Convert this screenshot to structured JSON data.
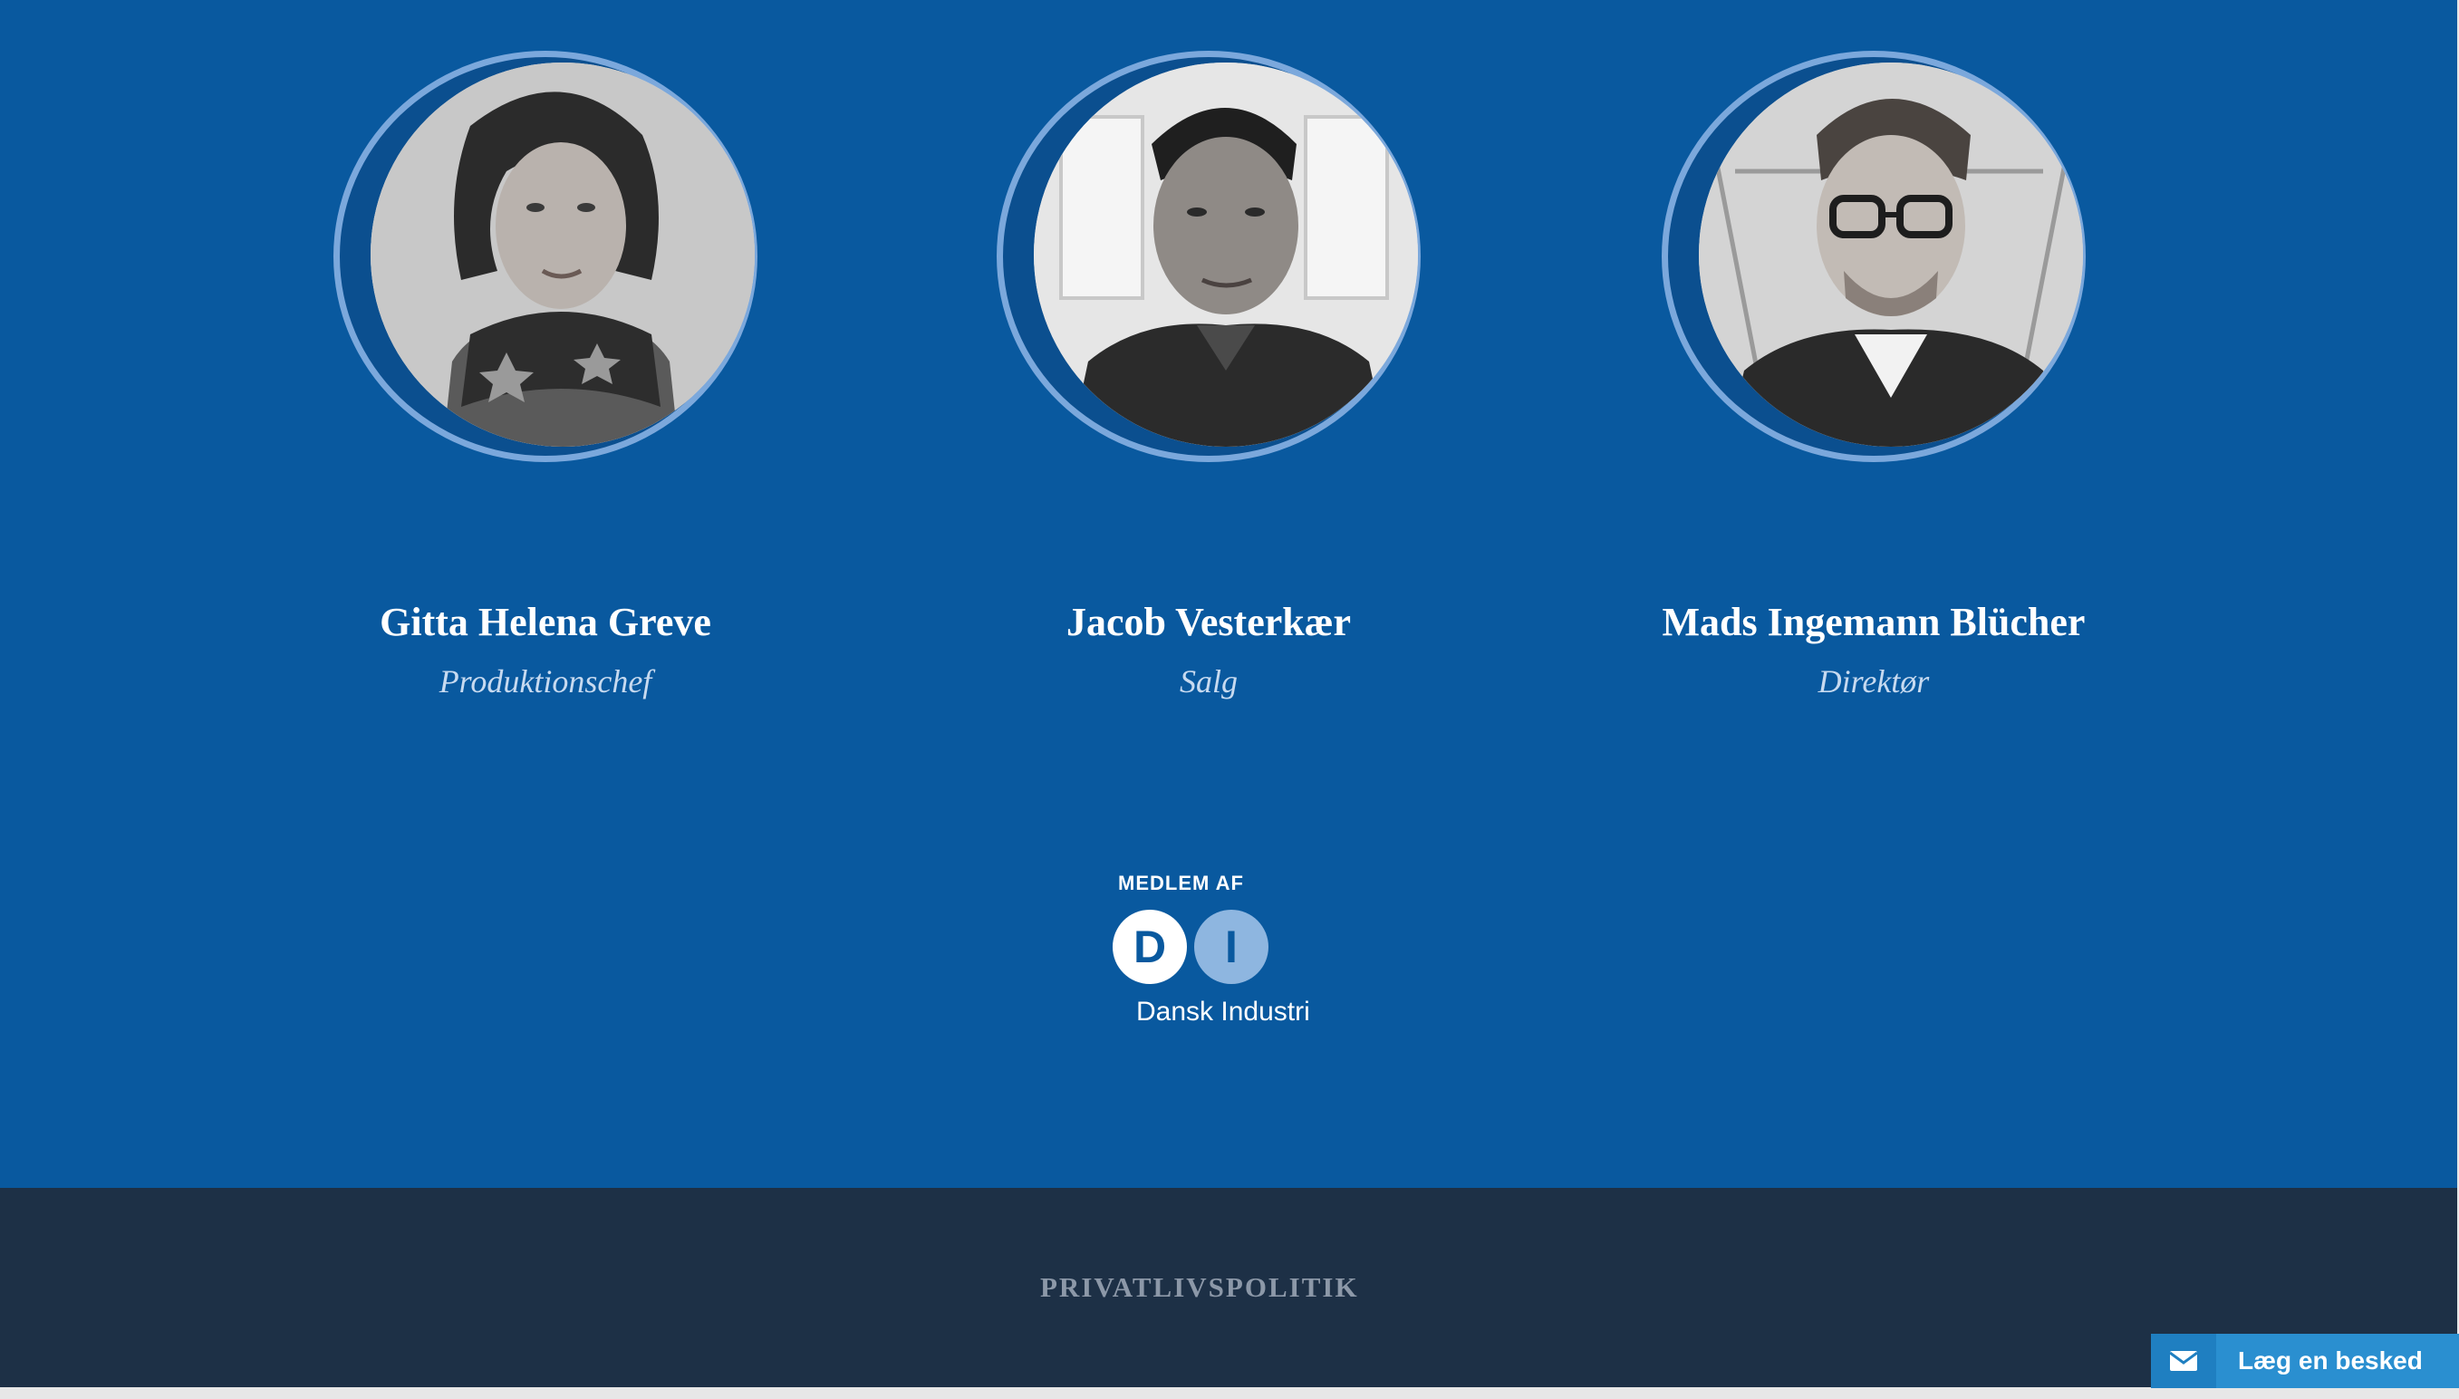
{
  "team": {
    "members": [
      {
        "name": "Gitta Helena Greve",
        "role": "Produktionschef"
      },
      {
        "name": "Jacob Vesterkær",
        "role": "Salg"
      },
      {
        "name": "Mads Ingemann Blücher",
        "role": "Direktør"
      }
    ]
  },
  "membership": {
    "label": "MEDLEM AF",
    "logo_letters": [
      "D",
      "I"
    ],
    "organization": "Dansk Industri"
  },
  "footer": {
    "privacy_link": "PRIVATLIVSPOLITIK"
  },
  "chat_widget": {
    "label": "Læg en besked",
    "icon": "envelope-icon"
  },
  "colors": {
    "main_background": "#09599f",
    "footer_background": "#1d3046",
    "ring": "#7ba8dc",
    "chat_button": "#2a8fd0"
  }
}
